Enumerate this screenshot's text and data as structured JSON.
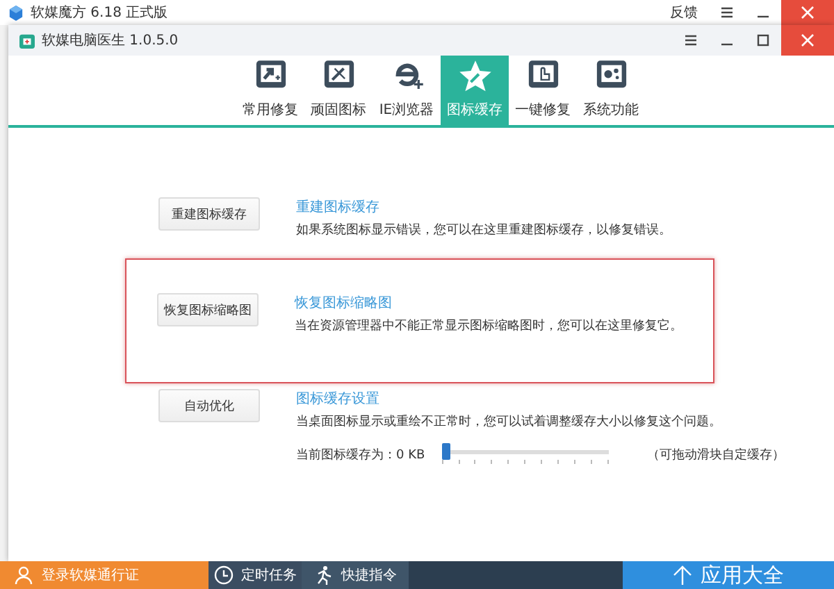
{
  "outer_window": {
    "title": "软媒魔方 6.18 正式版",
    "feedback": "反馈"
  },
  "window": {
    "title": "软媒电脑医生 1.0.5.0"
  },
  "tabs": [
    {
      "label": "常用修复",
      "kind": "repair",
      "selected": false
    },
    {
      "label": "顽固图标",
      "kind": "tools",
      "selected": false
    },
    {
      "label": "IE浏览器",
      "kind": "ie",
      "selected": false
    },
    {
      "label": "图标缓存",
      "kind": "star",
      "selected": true
    },
    {
      "label": "一键修复",
      "kind": "hand",
      "selected": false
    },
    {
      "label": "系统功能",
      "kind": "gears",
      "selected": false
    }
  ],
  "actions": [
    {
      "button": "重建图标缓存",
      "title": "重建图标缓存",
      "description": "如果系统图标显示错误，您可以在这里重建图标缓存，以修复错误。",
      "highlighted": false
    },
    {
      "button": "恢复图标缩略图",
      "title": "恢复图标缩略图",
      "description": "当在资源管理器中不能正常显示图标缩略图时，您可以在这里修复它。",
      "highlighted": true
    },
    {
      "button": "自动优化",
      "title": "图标缓存设置",
      "description": "当桌面图标显示或重绘不正常时，您可以试着调整缓存大小以修复这个问题。",
      "slider": {
        "label": "当前图标缓存为：0 KB",
        "level": 0,
        "hint": "（可拖动滑块自定缓存）"
      }
    }
  ],
  "taskbar": {
    "login": "登录软媒通行证",
    "schedule": "定时任务",
    "shortcuts": "快捷指令",
    "apps": "应用大全"
  }
}
